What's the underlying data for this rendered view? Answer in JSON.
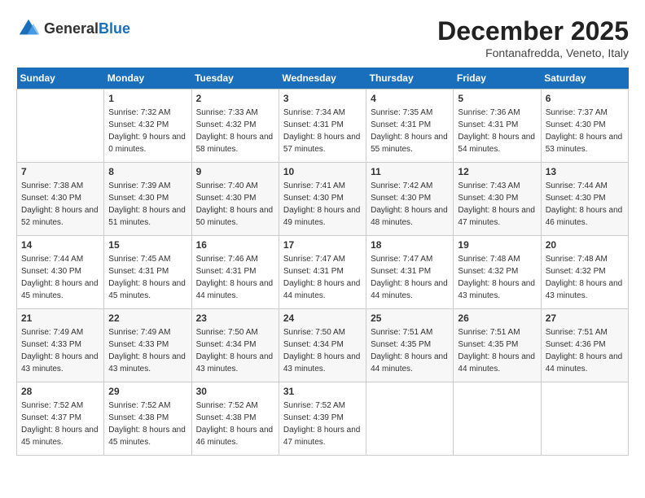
{
  "logo": {
    "general": "General",
    "blue": "Blue"
  },
  "title": "December 2025",
  "location": "Fontanafredda, Veneto, Italy",
  "days_of_week": [
    "Sunday",
    "Monday",
    "Tuesday",
    "Wednesday",
    "Thursday",
    "Friday",
    "Saturday"
  ],
  "weeks": [
    [
      {
        "day": "",
        "sunrise": "",
        "sunset": "",
        "daylight": ""
      },
      {
        "day": "1",
        "sunrise": "Sunrise: 7:32 AM",
        "sunset": "Sunset: 4:32 PM",
        "daylight": "Daylight: 9 hours and 0 minutes."
      },
      {
        "day": "2",
        "sunrise": "Sunrise: 7:33 AM",
        "sunset": "Sunset: 4:32 PM",
        "daylight": "Daylight: 8 hours and 58 minutes."
      },
      {
        "day": "3",
        "sunrise": "Sunrise: 7:34 AM",
        "sunset": "Sunset: 4:31 PM",
        "daylight": "Daylight: 8 hours and 57 minutes."
      },
      {
        "day": "4",
        "sunrise": "Sunrise: 7:35 AM",
        "sunset": "Sunset: 4:31 PM",
        "daylight": "Daylight: 8 hours and 55 minutes."
      },
      {
        "day": "5",
        "sunrise": "Sunrise: 7:36 AM",
        "sunset": "Sunset: 4:31 PM",
        "daylight": "Daylight: 8 hours and 54 minutes."
      },
      {
        "day": "6",
        "sunrise": "Sunrise: 7:37 AM",
        "sunset": "Sunset: 4:30 PM",
        "daylight": "Daylight: 8 hours and 53 minutes."
      }
    ],
    [
      {
        "day": "7",
        "sunrise": "Sunrise: 7:38 AM",
        "sunset": "Sunset: 4:30 PM",
        "daylight": "Daylight: 8 hours and 52 minutes."
      },
      {
        "day": "8",
        "sunrise": "Sunrise: 7:39 AM",
        "sunset": "Sunset: 4:30 PM",
        "daylight": "Daylight: 8 hours and 51 minutes."
      },
      {
        "day": "9",
        "sunrise": "Sunrise: 7:40 AM",
        "sunset": "Sunset: 4:30 PM",
        "daylight": "Daylight: 8 hours and 50 minutes."
      },
      {
        "day": "10",
        "sunrise": "Sunrise: 7:41 AM",
        "sunset": "Sunset: 4:30 PM",
        "daylight": "Daylight: 8 hours and 49 minutes."
      },
      {
        "day": "11",
        "sunrise": "Sunrise: 7:42 AM",
        "sunset": "Sunset: 4:30 PM",
        "daylight": "Daylight: 8 hours and 48 minutes."
      },
      {
        "day": "12",
        "sunrise": "Sunrise: 7:43 AM",
        "sunset": "Sunset: 4:30 PM",
        "daylight": "Daylight: 8 hours and 47 minutes."
      },
      {
        "day": "13",
        "sunrise": "Sunrise: 7:44 AM",
        "sunset": "Sunset: 4:30 PM",
        "daylight": "Daylight: 8 hours and 46 minutes."
      }
    ],
    [
      {
        "day": "14",
        "sunrise": "Sunrise: 7:44 AM",
        "sunset": "Sunset: 4:30 PM",
        "daylight": "Daylight: 8 hours and 45 minutes."
      },
      {
        "day": "15",
        "sunrise": "Sunrise: 7:45 AM",
        "sunset": "Sunset: 4:31 PM",
        "daylight": "Daylight: 8 hours and 45 minutes."
      },
      {
        "day": "16",
        "sunrise": "Sunrise: 7:46 AM",
        "sunset": "Sunset: 4:31 PM",
        "daylight": "Daylight: 8 hours and 44 minutes."
      },
      {
        "day": "17",
        "sunrise": "Sunrise: 7:47 AM",
        "sunset": "Sunset: 4:31 PM",
        "daylight": "Daylight: 8 hours and 44 minutes."
      },
      {
        "day": "18",
        "sunrise": "Sunrise: 7:47 AM",
        "sunset": "Sunset: 4:31 PM",
        "daylight": "Daylight: 8 hours and 44 minutes."
      },
      {
        "day": "19",
        "sunrise": "Sunrise: 7:48 AM",
        "sunset": "Sunset: 4:32 PM",
        "daylight": "Daylight: 8 hours and 43 minutes."
      },
      {
        "day": "20",
        "sunrise": "Sunrise: 7:48 AM",
        "sunset": "Sunset: 4:32 PM",
        "daylight": "Daylight: 8 hours and 43 minutes."
      }
    ],
    [
      {
        "day": "21",
        "sunrise": "Sunrise: 7:49 AM",
        "sunset": "Sunset: 4:33 PM",
        "daylight": "Daylight: 8 hours and 43 minutes."
      },
      {
        "day": "22",
        "sunrise": "Sunrise: 7:49 AM",
        "sunset": "Sunset: 4:33 PM",
        "daylight": "Daylight: 8 hours and 43 minutes."
      },
      {
        "day": "23",
        "sunrise": "Sunrise: 7:50 AM",
        "sunset": "Sunset: 4:34 PM",
        "daylight": "Daylight: 8 hours and 43 minutes."
      },
      {
        "day": "24",
        "sunrise": "Sunrise: 7:50 AM",
        "sunset": "Sunset: 4:34 PM",
        "daylight": "Daylight: 8 hours and 43 minutes."
      },
      {
        "day": "25",
        "sunrise": "Sunrise: 7:51 AM",
        "sunset": "Sunset: 4:35 PM",
        "daylight": "Daylight: 8 hours and 44 minutes."
      },
      {
        "day": "26",
        "sunrise": "Sunrise: 7:51 AM",
        "sunset": "Sunset: 4:35 PM",
        "daylight": "Daylight: 8 hours and 44 minutes."
      },
      {
        "day": "27",
        "sunrise": "Sunrise: 7:51 AM",
        "sunset": "Sunset: 4:36 PM",
        "daylight": "Daylight: 8 hours and 44 minutes."
      }
    ],
    [
      {
        "day": "28",
        "sunrise": "Sunrise: 7:52 AM",
        "sunset": "Sunset: 4:37 PM",
        "daylight": "Daylight: 8 hours and 45 minutes."
      },
      {
        "day": "29",
        "sunrise": "Sunrise: 7:52 AM",
        "sunset": "Sunset: 4:38 PM",
        "daylight": "Daylight: 8 hours and 45 minutes."
      },
      {
        "day": "30",
        "sunrise": "Sunrise: 7:52 AM",
        "sunset": "Sunset: 4:38 PM",
        "daylight": "Daylight: 8 hours and 46 minutes."
      },
      {
        "day": "31",
        "sunrise": "Sunrise: 7:52 AM",
        "sunset": "Sunset: 4:39 PM",
        "daylight": "Daylight: 8 hours and 47 minutes."
      },
      {
        "day": "",
        "sunrise": "",
        "sunset": "",
        "daylight": ""
      },
      {
        "day": "",
        "sunrise": "",
        "sunset": "",
        "daylight": ""
      },
      {
        "day": "",
        "sunrise": "",
        "sunset": "",
        "daylight": ""
      }
    ]
  ]
}
